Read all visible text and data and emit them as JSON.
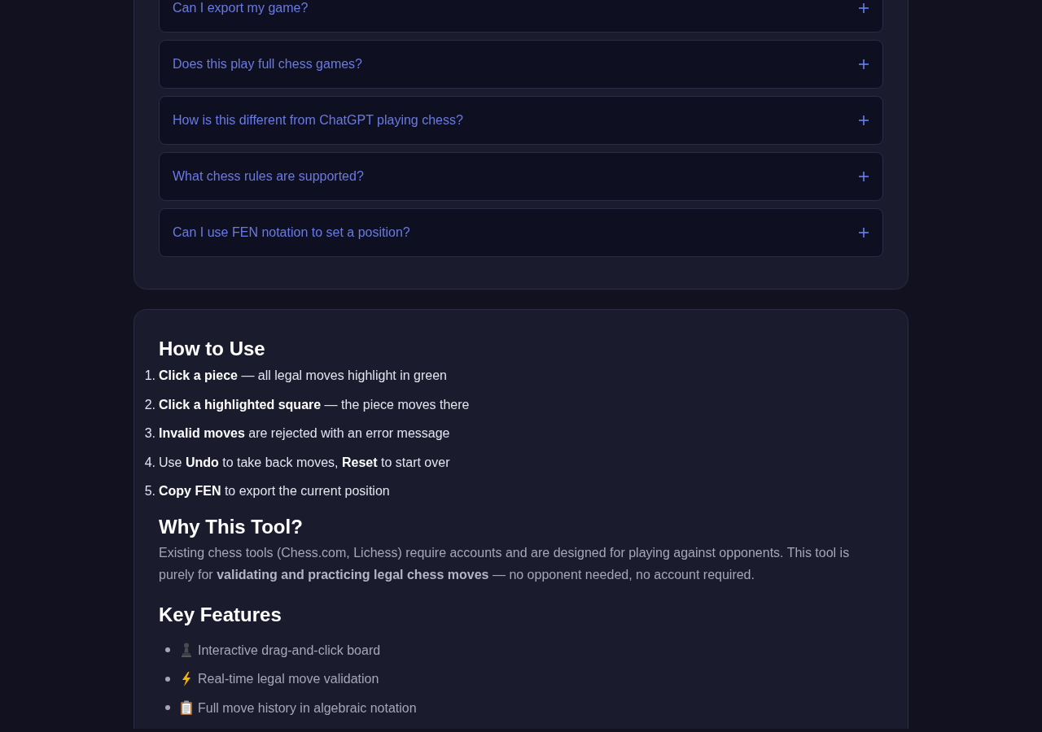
{
  "faq": {
    "items": [
      {
        "question": "Can I export my game?",
        "expanded": false
      },
      {
        "question": "Does this play full chess games?",
        "expanded": false
      },
      {
        "question": "How is this different from ChatGPT playing chess?",
        "expanded": false
      },
      {
        "question": "What chess rules are supported?",
        "expanded": false
      },
      {
        "question": "Can I use FEN notation to set a position?",
        "expanded": false
      }
    ]
  },
  "how_to_use": {
    "heading": "How to Use",
    "steps": [
      {
        "number": "1.",
        "text": "**Click a piece** — all legal moves highlight in green"
      },
      {
        "number": "2.",
        "text": "**Click a highlighted square** — the piece moves there"
      },
      {
        "number": "3.",
        "text": "**Invalid moves** are rejected with an error message"
      },
      {
        "number": "4.",
        "text": "Use **Undo** to take back moves, **Reset** to start over"
      },
      {
        "number": "5.",
        "text": "**Copy FEN** to export the current position"
      }
    ]
  },
  "why_this_tool": {
    "heading": "Why This Tool?",
    "text": "Existing chess tools (Chess.com, Lichess) require accounts and are designed for playing against opponents. This tool is purely for **validating and practicing legal chess moves** — no opponent needed, no account required."
  },
  "key_features": {
    "heading": "Key Features",
    "items": [
      "Interactive drag-and-click board",
      "Real-time legal move validation",
      "Full move history in algebraic notation"
    ]
  }
}
